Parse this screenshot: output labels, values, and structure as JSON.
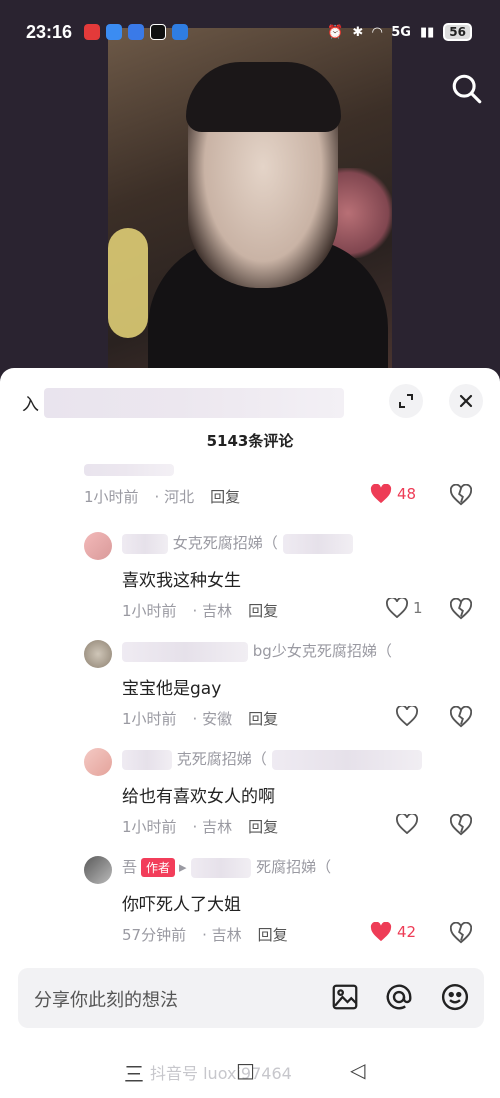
{
  "status_bar": {
    "time": "23:16",
    "network": "5G",
    "battery": "56"
  },
  "video": {
    "search_icon": "search-icon"
  },
  "sheet": {
    "top_partial_text": "入",
    "comment_count": "5143条评论",
    "expand_icon": "expand-icon",
    "close_icon": "close-icon"
  },
  "comments": [
    {
      "name": "",
      "text": "",
      "time": "1小时前",
      "location": "河北",
      "reply": "回复",
      "likes": "48",
      "liked": true
    },
    {
      "name": "女克死腐招娣（",
      "text": "喜欢我这种女生",
      "time": "1小时前",
      "location": "吉林",
      "reply": "回复",
      "likes": "1",
      "liked": false
    },
    {
      "name": "bg少女克死腐招娣（",
      "text": "宝宝他是gay",
      "time": "1小时前",
      "location": "安徽",
      "reply": "回复",
      "likes": "",
      "liked": false
    },
    {
      "name": "克死腐招娣（",
      "text": "给也有喜欢女人的啊",
      "time": "1小时前",
      "location": "吉林",
      "reply": "回复",
      "likes": "",
      "liked": false
    },
    {
      "name": "吾",
      "author_tag": "作者",
      "reply_to": "死腐招娣（",
      "text": "你吓死人了大姐",
      "time": "57分钟前",
      "location": "吉林",
      "reply": "回复",
      "likes": "42",
      "liked": true
    }
  ],
  "input": {
    "placeholder": "分享你此刻的想法",
    "icons": [
      "image-icon",
      "at-icon",
      "emoji-icon"
    ]
  },
  "navbar": {
    "menu": "三",
    "home": "□",
    "back": "◁",
    "watermark": "抖音号",
    "watermark_id": "luoxi97464"
  },
  "colors": {
    "accent": "#ee3c56",
    "author_tag": "#f23d5a"
  }
}
